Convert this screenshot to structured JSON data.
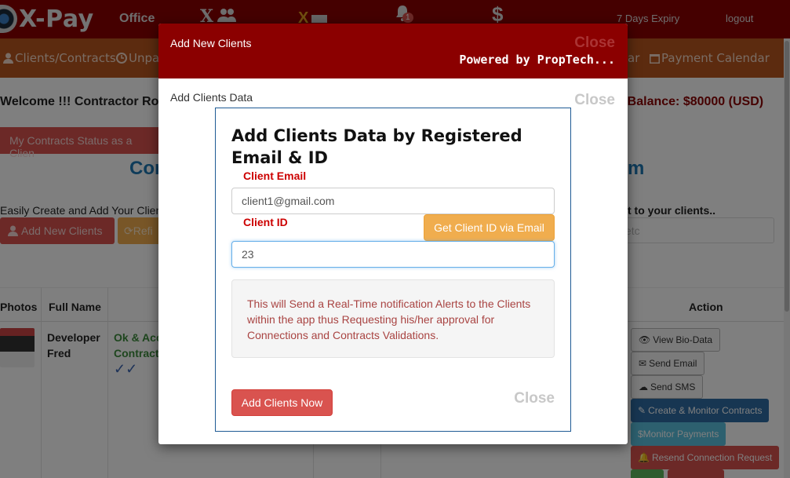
{
  "navbar": {
    "brand": "X-Pay",
    "office": "Office",
    "x_label": "X",
    "alert_count": "1",
    "dollar": "$",
    "expiry": "7 Days Expiry",
    "logout": "logout"
  },
  "subnav": {
    "clients": "Clients/Contracts",
    "unpaid": "Unpaid",
    "ar": "ar",
    "payment_calendar": "Payment Calendar"
  },
  "page": {
    "welcome": "Welcome !!! Contractor Ro",
    "balance": "r Balance: $80000 (USD)",
    "status_button": "My Contracts Status as a Clien",
    "heading_left": "Cor",
    "heading_right": "m",
    "easy_text": "Easily Create and Add Your Clien",
    "send_text": "t to your clients..",
    "add_new_clients": "Add New Clients",
    "refresh": "Refi",
    "search_placeholder": "etc",
    "table": {
      "photos": "Photos",
      "full_name": "Full Name",
      "action": "Action"
    },
    "row": {
      "name_line1": "Developer",
      "name_line2": "Fred",
      "status_line1": "Ok & Acc",
      "status_line2": "Contract",
      "ticks": "✓✓"
    },
    "actions": {
      "view_bio": "View Bio-Data",
      "send_email": "Send Email",
      "send_sms": "Send SMS",
      "create_monitor": "Create & Monitor Contracts",
      "monitor_payments": "$Monitor Payments",
      "resend": "Resend Connection Request"
    }
  },
  "modal": {
    "title": "Add New Clients",
    "close_top": "Close",
    "powered": "Powered by PropTech...",
    "subtitle": "Add Clients Data",
    "close_2": "Close",
    "form": {
      "title": "Add Clients Data by Registered Email & ID",
      "email_label": "Client Email",
      "email_value": "client1@gmail.com",
      "id_label": "Client ID",
      "get_id_button": "Get Client ID via Email",
      "id_value": "23",
      "notice": "This will Send a Real-Time notification Alerts to the Clients within the app thus Requesting his/her approval for Connections and Contracts Validations.",
      "add_button": "Add Clients Now",
      "close": "Close"
    }
  },
  "colors": {
    "navbar": "#8b0000",
    "subnav": "#b8561e",
    "danger": "#d9534f",
    "warning": "#f0ad4e",
    "primary": "#2e6da4"
  }
}
